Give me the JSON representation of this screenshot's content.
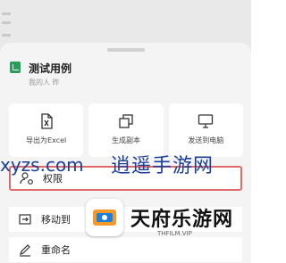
{
  "document": {
    "title": "测试用例",
    "meta": "我的人 昨"
  },
  "actions": [
    {
      "label": "导出为Excel",
      "icon": "excel-file-icon"
    },
    {
      "label": "生成副本",
      "icon": "copy-icon"
    },
    {
      "label": "发送到电脑",
      "icon": "monitor-icon"
    }
  ],
  "menu": {
    "permissions": {
      "label": "权限",
      "icon": "user-settings-icon"
    },
    "move": {
      "label": "移动到",
      "icon": "move-icon"
    },
    "rename": {
      "label": "重命名",
      "icon": "pencil-icon"
    }
  },
  "watermark": {
    "url": "xyzs.com",
    "brand_cn": "逍遥手游网",
    "logo_text": "天府乐游网",
    "logo_sub": "THFILM.VIP"
  },
  "colors": {
    "accent_green": "#2a9d5b",
    "highlight_border": "#e06a6a",
    "watermark_blue": "#1b3f9a"
  }
}
